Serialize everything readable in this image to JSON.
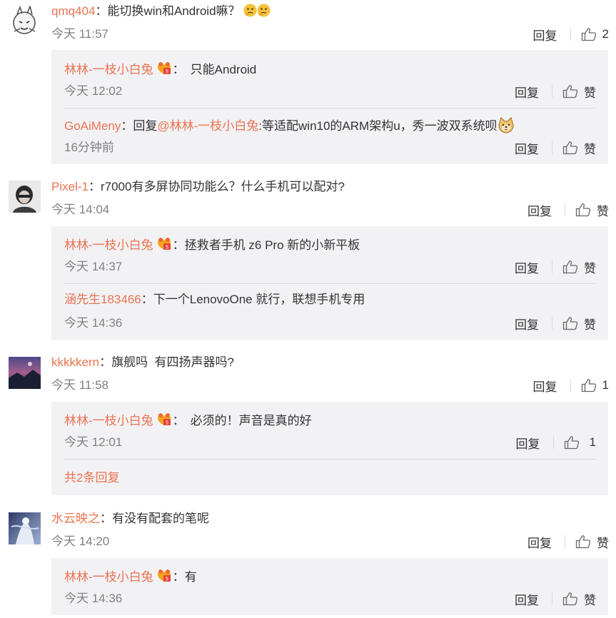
{
  "c1": {
    "user": "qmq404",
    "sep": "：",
    "text": "能切换win和Android嘛？",
    "time": "今天 11:57",
    "reply": "回复",
    "likes": "2",
    "replies": [
      {
        "user": "林林-一枝小白兔",
        "sep": "：",
        "text": "只能Android",
        "time": "今天 12:02",
        "reply": "回复",
        "likes": "赞"
      },
      {
        "user": "GoAiMeny",
        "sep": "：",
        "reply_prefix": "回复",
        "mention": "@林林-一枝小白兔",
        "text": ":等适配win10的ARM架构u，秀一波双系统呗",
        "time": "16分钟前",
        "reply": "回复",
        "likes": "赞"
      }
    ]
  },
  "c2": {
    "user": "Pixel-1",
    "sep": "：",
    "text": "r7000有多屏协同功能么？什么手机可以配对?",
    "time": "今天 14:04",
    "reply": "回复",
    "likes": "赞",
    "replies": [
      {
        "user": "林林-一枝小白兔",
        "sep": "：",
        "text": "拯救者手机 z6 Pro 新的小新平板",
        "time": "今天 14:37",
        "reply": "回复",
        "likes": "赞"
      },
      {
        "user": "涵先生183466",
        "sep": "：",
        "text": "下一个LenovoOne 就行，联想手机专用",
        "time": "今天 14:36",
        "reply": "回复",
        "likes": "赞"
      }
    ]
  },
  "c3": {
    "user": "kkkkkern",
    "sep": "：",
    "text": "旗舰吗  有四扬声器吗?",
    "time": "今天 11:58",
    "reply": "回复",
    "likes": "1",
    "replies": [
      {
        "user": "林林-一枝小白兔",
        "sep": "：",
        "text": "必须的！声音是真的好",
        "time": "今天 12:01",
        "reply": "回复",
        "likes": "1"
      }
    ],
    "more": "共2条回复"
  },
  "c4": {
    "user": "水云映之",
    "sep": "：",
    "text": "有没有配套的笔呢",
    "time": "今天 14:20",
    "reply": "回复",
    "likes": "赞",
    "replies": [
      {
        "user": "林林-一枝小白兔",
        "sep": "：",
        "text": "有",
        "time": "今天 14:36",
        "reply": "回复",
        "likes": "赞"
      }
    ]
  },
  "colors": {
    "username": "#eb7350",
    "meta": "#808080",
    "reply_bg": "#f2f2f5"
  },
  "icons": [
    "thumbs-up-icon",
    "vip-badge-icon",
    "thinking-emoji-icon",
    "doge-emoji-icon"
  ]
}
